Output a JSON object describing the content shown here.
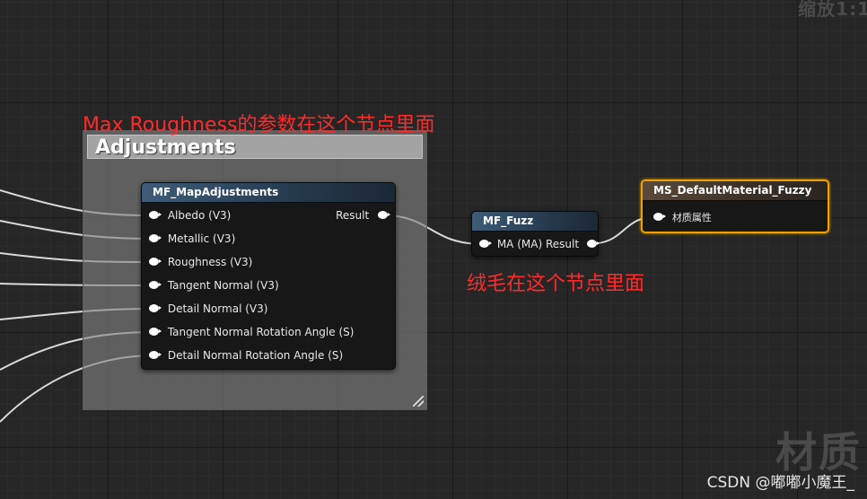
{
  "zoom_label": "缩放1:1",
  "comment": {
    "title": "Adjustments"
  },
  "annotations": {
    "max_roughness": "Max Roughness的参数在这个节点里面",
    "fuzz": "绒毛在这个节点里面"
  },
  "map_adjustments": {
    "title": "MF_MapAdjustments",
    "inputs": [
      "Albedo (V3)",
      "Metallic (V3)",
      "Roughness (V3)",
      "Tangent Normal (V3)",
      "Detail Normal (V3)",
      "Tangent Normal Rotation Angle (S)",
      "Detail Normal Rotation Angle (S)"
    ],
    "output": "Result"
  },
  "fuzz": {
    "title": "MF_Fuzz",
    "pin": "MA (MA) Result"
  },
  "material": {
    "title": "MS_DefaultMaterial_Fuzzy",
    "input": "材质属性"
  },
  "watermark": {
    "large": "材质",
    "credit": "CSDN @嘟嘟小魔王_"
  },
  "colors": {
    "selection": "#f0a000",
    "annotation": "#ff2a2a",
    "header_blue": "#3e5c78"
  }
}
